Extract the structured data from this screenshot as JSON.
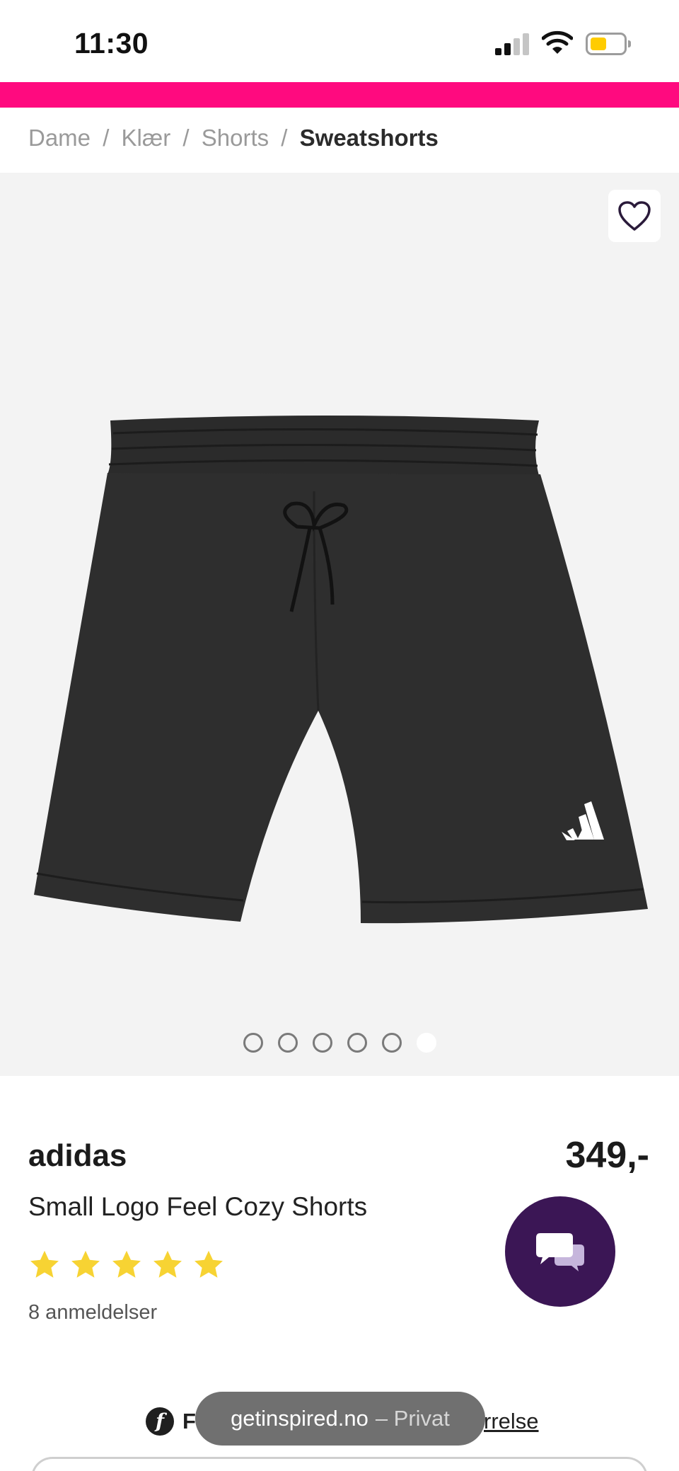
{
  "status_bar": {
    "time": "11:30",
    "battery_level": 0.5,
    "battery_color": "#ffcc00"
  },
  "banner": {
    "color": "#ff0a7f"
  },
  "breadcrumb": {
    "items": [
      "Dame",
      "Klær",
      "Shorts"
    ],
    "separator": "/",
    "current": "Sweatshorts"
  },
  "gallery": {
    "favorite_icon": "heart-outline-icon",
    "image_count": 6,
    "active_index": 5
  },
  "product": {
    "brand": "adidas",
    "price": "349,-",
    "name": "Small Logo Feel Cozy Shorts",
    "rating": 5,
    "rating_max": 5,
    "star_color": "#f7d333",
    "reviews_label": "8 anmeldelser"
  },
  "chat": {
    "icon": "chat-bubbles-icon",
    "color": "#3b1655"
  },
  "fit": {
    "icon": "fit-f-icon",
    "prefix": "F",
    "link_suffix": "rrelse"
  },
  "browser": {
    "domain": "getinspired.no",
    "mode": "– Privat"
  }
}
